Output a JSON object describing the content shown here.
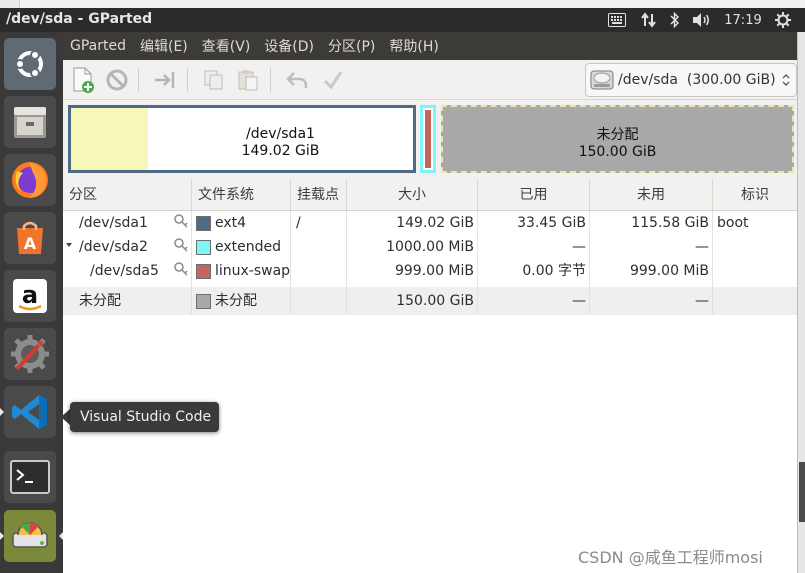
{
  "window": {
    "title": "/dev/sda - GParted"
  },
  "tray": {
    "clock": "17:19"
  },
  "launcher": {
    "items": [
      "ubuntu-icon",
      "files-icon",
      "firefox-icon",
      "software-center-icon",
      "amazon-icon",
      "system-settings-icon",
      "vscode-icon",
      "terminal-icon",
      "gparted-icon"
    ],
    "tooltip": "Visual Studio Code"
  },
  "menubar": {
    "items": [
      "GParted",
      "编辑(E)",
      "查看(V)",
      "设备(D)",
      "分区(P)",
      "帮助(H)"
    ]
  },
  "toolbar": {
    "device": "/dev/sda  (300.00 GiB)"
  },
  "visual": {
    "sda1": {
      "name": "/dev/sda1",
      "size": "149.02 GiB"
    },
    "unallocated": {
      "name": "未分配",
      "size": "150.00 GiB"
    }
  },
  "table": {
    "headers": [
      "分区",
      "文件系统",
      "挂载点",
      "大小",
      "已用",
      "未用",
      "标识"
    ],
    "rows": [
      {
        "partition": "/dev/sda1",
        "filesystem": "ext4",
        "fs_color": "#4f6a86",
        "mount": "/",
        "size": "149.02 GiB",
        "used": "33.45 GiB",
        "unused": "115.58 GiB",
        "flags": "boot"
      },
      {
        "partition": "/dev/sda2",
        "filesystem": "extended",
        "fs_color": "#7ef6f5",
        "mount": "",
        "size": "1000.00 MiB",
        "used": "—",
        "unused": "—",
        "flags": ""
      },
      {
        "partition": "/dev/sda5",
        "filesystem": "linux-swap",
        "fs_color": "#c5655c",
        "mount": "",
        "size": "999.00 MiB",
        "used": "0.00 字节",
        "unused": "999.00 MiB",
        "flags": ""
      },
      {
        "partition": "未分配",
        "filesystem": "未分配",
        "fs_color": "#a9a9a9",
        "mount": "",
        "size": "150.00 GiB",
        "used": "—",
        "unused": "—",
        "flags": ""
      }
    ]
  },
  "watermark": "CSDN @咸鱼工程师mosi"
}
